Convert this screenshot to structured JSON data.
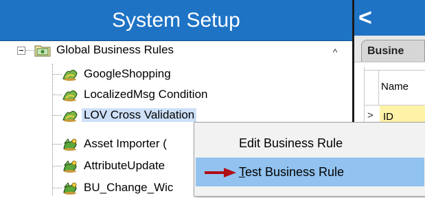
{
  "left_panel": {
    "title": "System Setup"
  },
  "tree": {
    "root": {
      "label": "Global Business Rules",
      "icon": "folder-icon"
    },
    "items": [
      {
        "label": "GoogleShopping",
        "icon": "condition-rule-icon"
      },
      {
        "label": "LocalizedMsg Condition",
        "icon": "condition-rule-icon"
      },
      {
        "label": "LOV Cross Validation",
        "icon": "condition-rule-icon",
        "selected": true
      },
      {
        "label": "Asset Importer (",
        "icon": "action-rule-icon"
      },
      {
        "label": "AttributeUpdate",
        "icon": "action-rule-icon"
      },
      {
        "label": "BU_Change_Wic",
        "icon": "action-rule-icon"
      }
    ],
    "scroll_up": "^"
  },
  "right_panel": {
    "back": "<",
    "tab_label": "Busine",
    "grid": {
      "column_name": "Name",
      "row_marker": ">",
      "row_value": "ID"
    }
  },
  "context_menu": {
    "items": [
      {
        "label": "Edit Business Rule"
      },
      {
        "label": "Test Business Rule",
        "underline_char": "T"
      }
    ]
  },
  "colors": {
    "header_blue": "#1e73c5",
    "menu_highlight": "#92c2ef",
    "selection": "#cde0f7",
    "grid_row_yellow": "#fff3a8",
    "arrow_red": "#b00d16"
  }
}
